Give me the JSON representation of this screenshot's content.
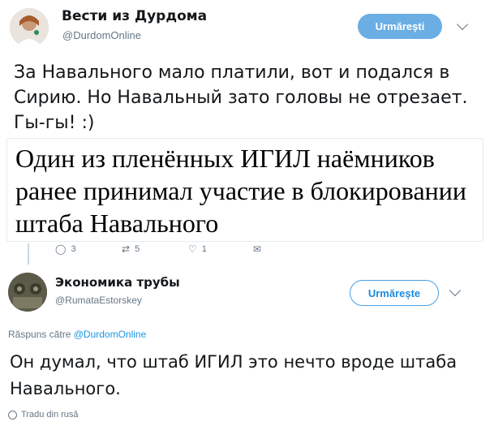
{
  "tweet1": {
    "name": "Вести из Дурдома",
    "handle": "@DurdomOnline",
    "follow_label": "Urmărești",
    "text": "За Навального мало платили, вот и подался в Сирию. Но Навальный зато головы не отрезает. Гы-гы! :)",
    "embed_text": "Один из пленённых ИГИЛ наёмников ранее принимал участие в блокировании штаба Навального",
    "reply_count": "3",
    "retweet_count": "5",
    "like_count": "1"
  },
  "tweet2": {
    "name": "Экономика трубы",
    "handle": "@RumataEstorskey",
    "follow_label": "Urmărește",
    "reply_prefix": "Răspuns către",
    "reply_handle": "@DurdomOnline",
    "text": "Он думал, что штаб ИГИЛ это нечто вроде штаба Навального.",
    "translate_label": "Tradu din rusă"
  },
  "colors": {
    "accent": "#1b95e0",
    "follow_filled": "#6aaee4",
    "muted": "#657786"
  },
  "icons": [
    "chevron-down-icon",
    "reply-icon",
    "retweet-icon",
    "like-icon",
    "message-icon",
    "globe-icon"
  ]
}
